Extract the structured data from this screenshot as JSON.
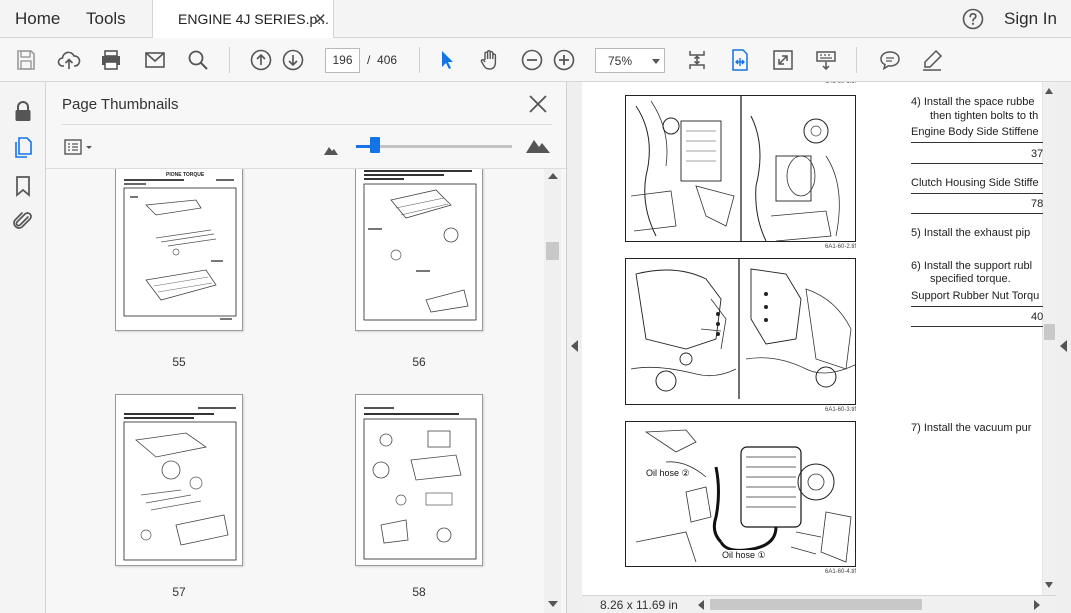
{
  "app": {
    "menu_home": "Home",
    "menu_tools": "Tools",
    "document_tab": "ENGINE 4J SERIES.p...",
    "sign_in": "Sign In",
    "accent_color": "#1473e6"
  },
  "toolbar": {
    "icons": [
      "save-icon",
      "cloud-upload-icon",
      "print-icon",
      "email-icon",
      "search-icon",
      "previous-page-icon",
      "next-page-icon",
      "select-tool-icon",
      "hand-tool-icon",
      "zoom-out-icon",
      "zoom-in-icon",
      "fit-page-icon",
      "fit-width-icon",
      "full-screen-icon",
      "keyboard-icon",
      "comment-icon",
      "highlight-icon"
    ],
    "current_page": "196",
    "page_separator": "/",
    "total_pages": "406",
    "zoom": "75%"
  },
  "sidebar": {
    "icons": [
      "lock-icon",
      "page-thumbnails-icon",
      "bookmark-icon",
      "attachment-icon"
    ]
  },
  "thumbnails": {
    "title": "Page Thumbnails",
    "slider_level": 0.12,
    "pages": [
      {
        "number": "55",
        "heading": "PIONE TORQUE"
      },
      {
        "number": "56",
        "heading": ""
      },
      {
        "number": "57",
        "heading": ""
      },
      {
        "number": "58",
        "heading": ""
      }
    ]
  },
  "document": {
    "figures": [
      {
        "code": "6A1-60-2.tif"
      },
      {
        "code": "6A1-60-3.tif"
      },
      {
        "code": "6A1-60-4.tif"
      }
    ],
    "oil_hose_2": "Oil hose ②",
    "oil_hose_1": "Oil hose ①",
    "steps": [
      {
        "line1": "4)   Install the space rubbe",
        "line2": "then tighten bolts to th"
      },
      {
        "line1": "5)   Install the exhaust pip"
      },
      {
        "line1": "6)   Install the support rubl",
        "line2": "specified torque."
      },
      {
        "line1": "7)   Install the vacuum pur"
      }
    ],
    "specs": [
      {
        "label": "Engine Body Side Stiffene",
        "value": "37"
      },
      {
        "label": "Clutch Housing Side Stiffe",
        "value": "78"
      },
      {
        "label": "Support Rubber Nut Torqu",
        "value": "40"
      }
    ],
    "page_size": "8.26 x 11.69 in"
  }
}
